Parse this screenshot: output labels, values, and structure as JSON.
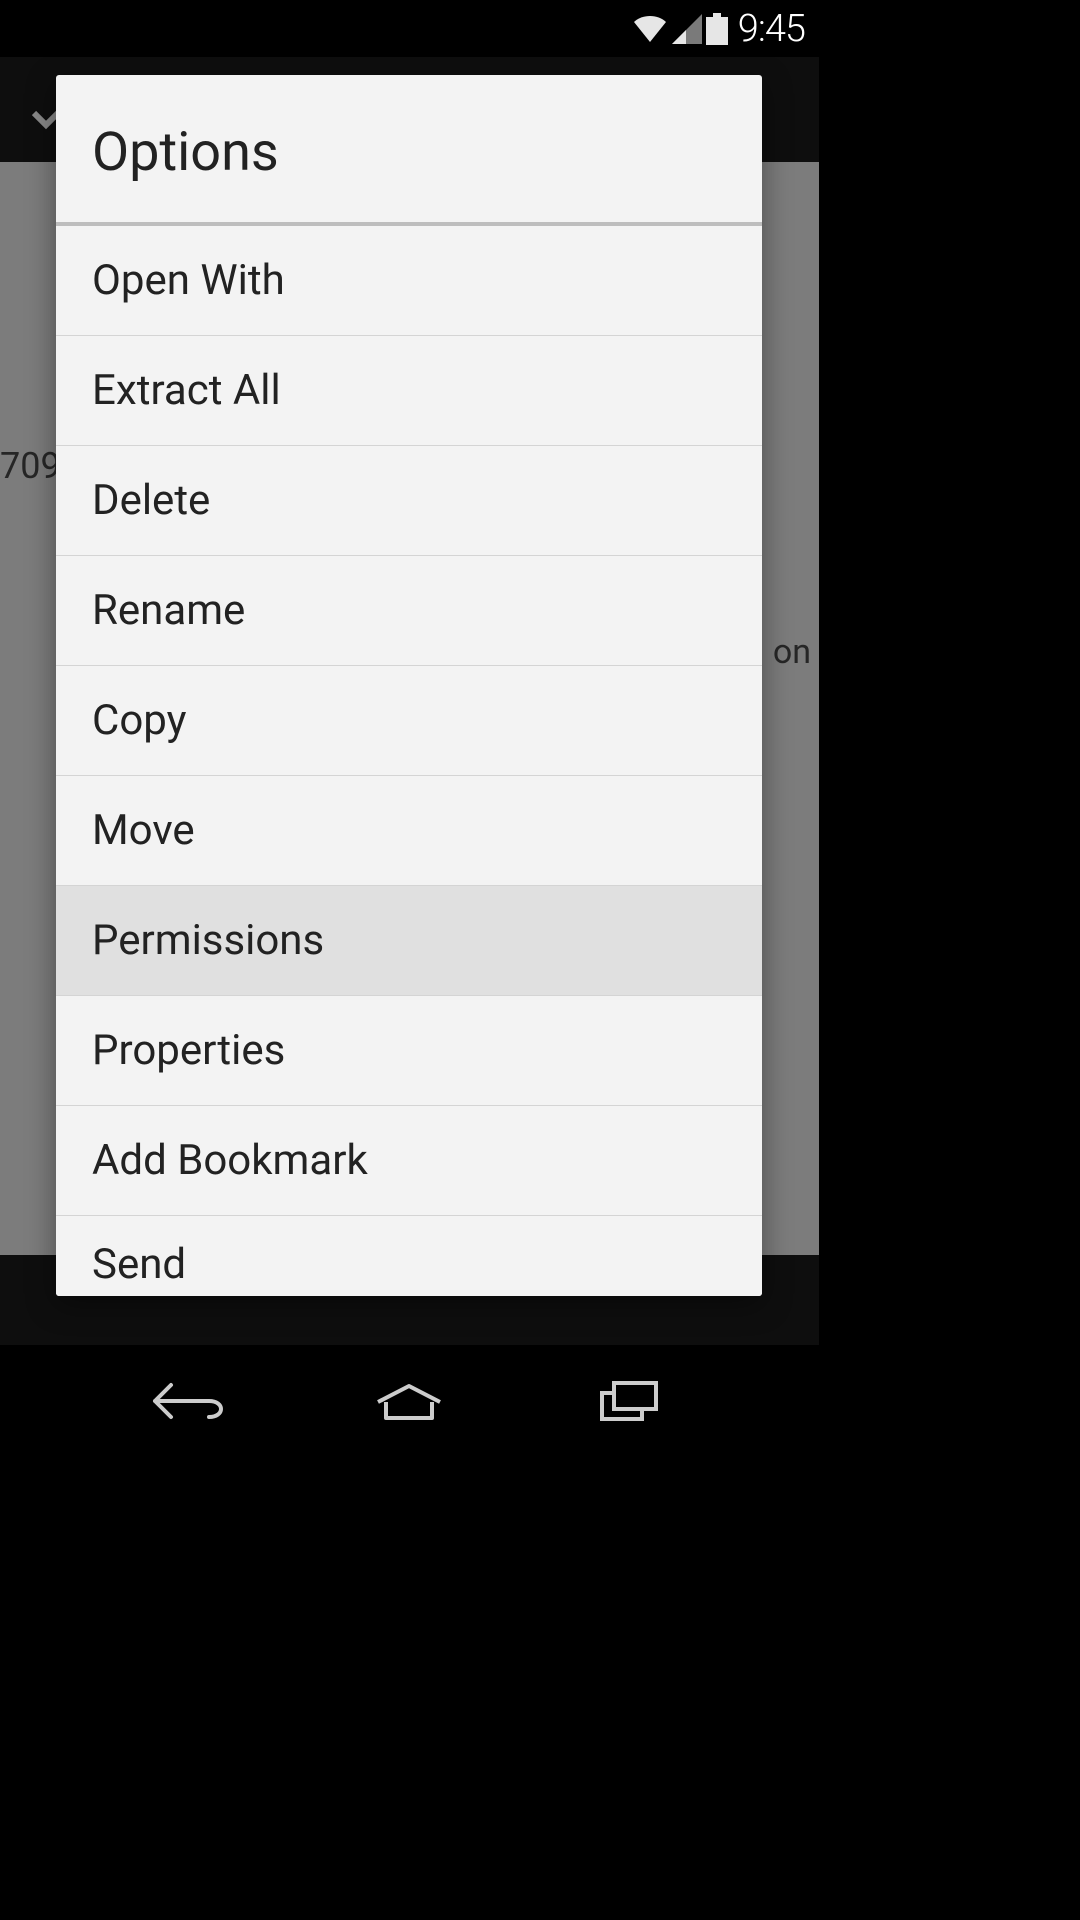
{
  "status_bar": {
    "clock": "9:45"
  },
  "background": {
    "left_text": "709",
    "right_text": "on"
  },
  "dialog": {
    "title": "Options",
    "options": [
      {
        "label": "Open With",
        "highlighted": false
      },
      {
        "label": "Extract All",
        "highlighted": false
      },
      {
        "label": "Delete",
        "highlighted": false
      },
      {
        "label": "Rename",
        "highlighted": false
      },
      {
        "label": "Copy",
        "highlighted": false
      },
      {
        "label": "Move",
        "highlighted": false
      },
      {
        "label": "Permissions",
        "highlighted": true
      },
      {
        "label": "Properties",
        "highlighted": false
      },
      {
        "label": "Add Bookmark",
        "highlighted": false
      },
      {
        "label": "Send",
        "highlighted": false
      }
    ]
  }
}
